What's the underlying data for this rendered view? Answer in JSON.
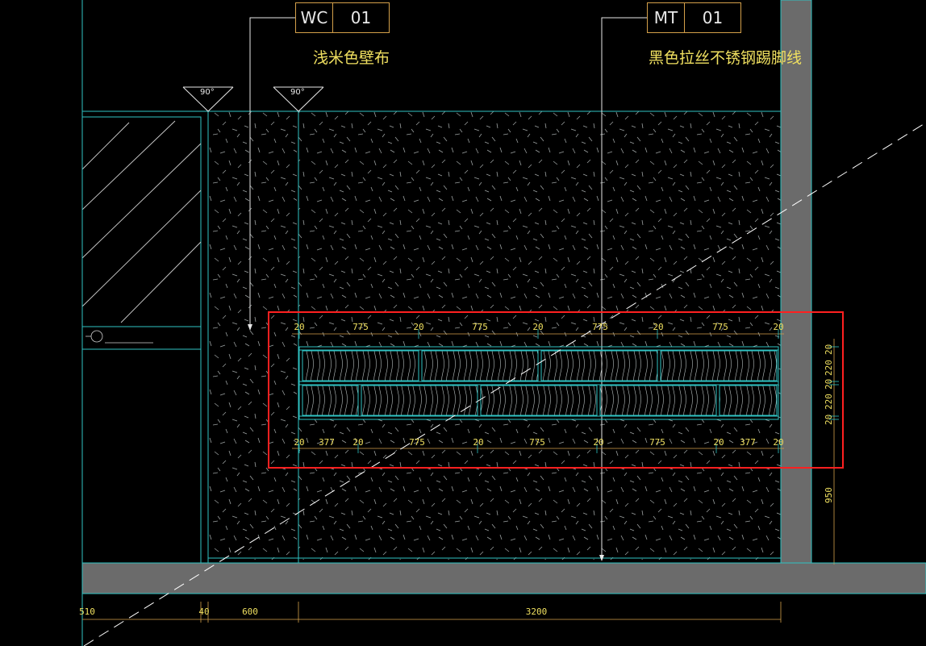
{
  "tags": [
    {
      "code": "WC",
      "num": "01",
      "caption": "浅米色壁布"
    },
    {
      "code": "MT",
      "num": "01",
      "caption": "黑色拉丝不锈钢踢脚线"
    }
  ],
  "angles": [
    "90°",
    "90°"
  ],
  "dims": {
    "top_row": [
      "20",
      "775",
      "20",
      "775",
      "20",
      "775",
      "20",
      "775",
      "20"
    ],
    "bottom_row": [
      "20",
      "377",
      "20",
      "775",
      "20",
      "775",
      "20",
      "775",
      "20",
      "377",
      "20"
    ],
    "right_col": [
      "20",
      "220",
      "20",
      "220",
      "20"
    ],
    "right_tall": "950",
    "floor_row": [
      "510",
      "40",
      "600",
      "3200"
    ]
  },
  "colors": {
    "background": "#000000",
    "cyan_lines": "#2fc3c3",
    "gray_wall": "#6b6b6b",
    "highlight_box": "#ff2020",
    "dim_text": "#f0e060",
    "tag_border": "#d4a04a"
  }
}
